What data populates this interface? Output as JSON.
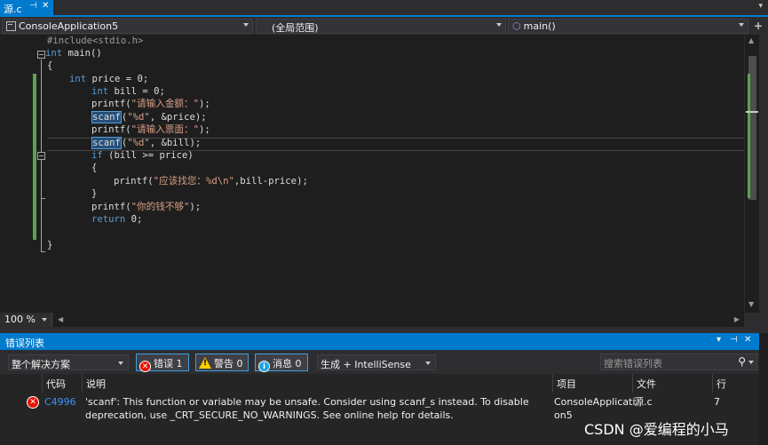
{
  "tab": {
    "name": "源.c",
    "pin": "⊣",
    "close": "✕",
    "overflow": "▾"
  },
  "nav": {
    "project": "ConsoleApplication5",
    "scope": "(全局范围)",
    "member": "main()"
  },
  "code_lines": [
    "#include<stdio.h>",
    "int main()",
    "{",
    "    int price = 0;",
    "        int bill = 0;",
    "        printf(\"请输入金额：\");",
    "        scanf(\"%d\", &price);",
    "        printf(\"请输入票面：\");",
    "        scanf(\"%d\", &bill);",
    "        if (bill >= price)",
    "        {",
    "            printf(\"应该找您：%d\\n\",bill-price);",
    "        }",
    "        printf(\"你的钱不够\");",
    "        return 0;",
    "",
    "}"
  ],
  "zoom": "100 %",
  "error_list": {
    "title": "错误列表",
    "scope": "整个解决方案",
    "errors_label": "错误 1",
    "warnings_label": "警告 0",
    "messages_label": "消息 0",
    "build_filter": "生成 + IntelliSense",
    "search_placeholder": "搜索错误列表",
    "columns": {
      "code": "代码",
      "description": "说明",
      "project": "项目",
      "file": "文件",
      "line": "行"
    },
    "rows": [
      {
        "code": "C4996",
        "description_1": "'scanf': This function or variable may be unsafe. Consider using scanf_s instead. To disable",
        "description_2": "deprecation, use _CRT_SECURE_NO_WARNINGS. See online help for details.",
        "project_1": "ConsoleApplicati",
        "project_2": "on5",
        "file": "源.c",
        "line": "7"
      }
    ]
  },
  "watermark": "CSDN @爱编程的小马",
  "colors": {
    "accent": "#007acc",
    "keyword": "#569cd6",
    "string": "#d69d85",
    "change_bar": "#57a64a",
    "error": "#e51400"
  },
  "icons": [
    "project-icon",
    "member-cube-icon",
    "error-icon",
    "warning-icon",
    "info-icon",
    "search-icon",
    "pin-icon",
    "close-icon",
    "split-icon"
  ]
}
